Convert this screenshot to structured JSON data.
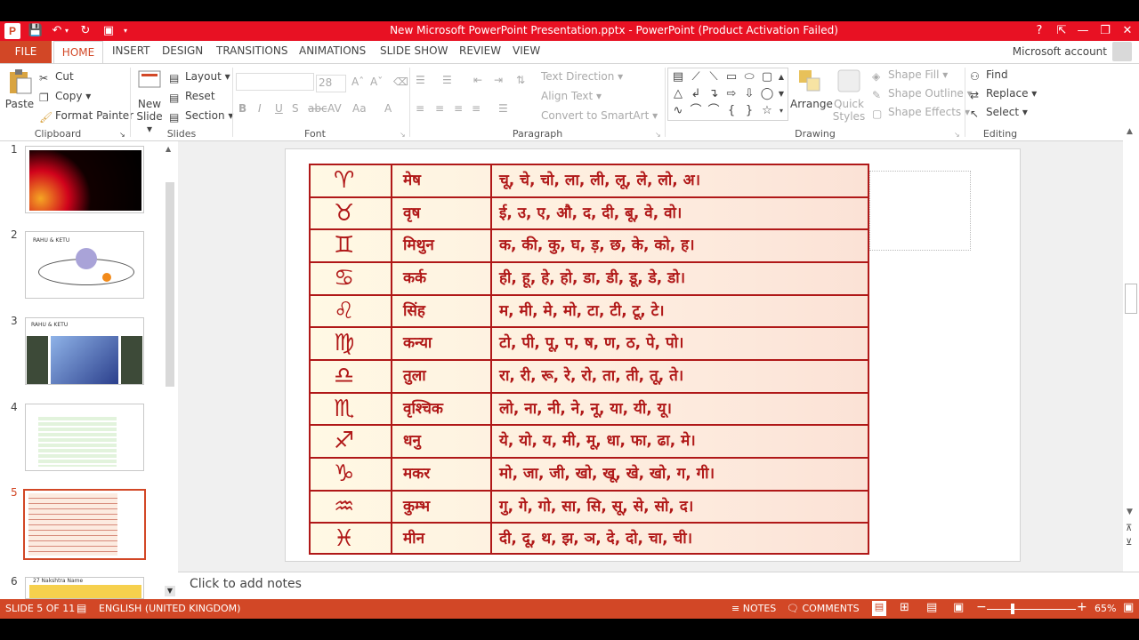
{
  "window": {
    "app_logo": "P",
    "title": "New Microsoft PowerPoint Presentation.pptx -  PowerPoint (Product Activation Failed)",
    "help": "?"
  },
  "tabs": {
    "file": "FILE",
    "items": [
      "HOME",
      "INSERT",
      "DESIGN",
      "TRANSITIONS",
      "ANIMATIONS",
      "SLIDE SHOW",
      "REVIEW",
      "VIEW"
    ],
    "account": "Microsoft account"
  },
  "ribbon": {
    "clipboard": {
      "paste": "Paste",
      "cut": "Cut",
      "copy": "Copy",
      "format_painter": "Format Painter",
      "label": "Clipboard"
    },
    "slides": {
      "new_slide": "New Slide",
      "layout": "Layout",
      "reset": "Reset",
      "section": "Section",
      "label": "Slides"
    },
    "font": {
      "size": "28",
      "label": "Font"
    },
    "paragraph": {
      "text_direction": "Text Direction",
      "align_text": "Align Text",
      "convert_smartart": "Convert to SmartArt",
      "label": "Paragraph"
    },
    "drawing": {
      "arrange": "Arrange",
      "quick_styles": "Quick Styles",
      "shape_fill": "Shape Fill",
      "shape_outline": "Shape Outline",
      "shape_effects": "Shape Effects",
      "label": "Drawing"
    },
    "editing": {
      "find": "Find",
      "replace": "Replace",
      "select": "Select",
      "label": "Editing"
    }
  },
  "thumbnails": [
    {
      "num": "1",
      "caption": ""
    },
    {
      "num": "2",
      "caption": "RAHU & KETU"
    },
    {
      "num": "3",
      "caption": "RAHU & KETU"
    },
    {
      "num": "4",
      "caption": ""
    },
    {
      "num": "5",
      "caption": ""
    },
    {
      "num": "6",
      "caption": "27 Nakshtra Name"
    }
  ],
  "slide": {
    "zodiac_table": [
      {
        "name": "मेष",
        "letters": "चू, चे, चो, ला, ली, लू, ले, लो, अ।"
      },
      {
        "name": "वृष",
        "letters": "ई, उ, ए, औ, द, दी, बू, वे, वो।"
      },
      {
        "name": "मिथुन",
        "letters": "क, की, कु, घ, ड़, छ, के, को, ह।"
      },
      {
        "name": "कर्क",
        "letters": "ही, हू, हे, हो, डा, डी, डू, डे, डो।"
      },
      {
        "name": "सिंह",
        "letters": "म, मी, मे, मो, टा, टी, टू, टे।"
      },
      {
        "name": "कन्या",
        "letters": "टो, पी, पू, प, ष, ण, ठ, पे, पो।"
      },
      {
        "name": "तुला",
        "letters": "रा, री, रू, रे, रो, ता, ती, तू, ते।"
      },
      {
        "name": "वृश्चिक",
        "letters": "लो, ना, नी, ने, नू, या, यी, यू।"
      },
      {
        "name": "धनु",
        "letters": "ये, यो, य, मी, मू, धा, फा, ढा, मे।"
      },
      {
        "name": "मकर",
        "letters": "मो, जा, जी, खो, खू, खे, खो, ग, गी।"
      },
      {
        "name": "कुम्भ",
        "letters": "गु, गे, गो, सा, सि, सू, से, सो, द।"
      },
      {
        "name": "मीन",
        "letters": "दी, दू, थ, झ, ञ, दे, दो, चा, ची।"
      }
    ]
  },
  "notes": {
    "placeholder": "Click to add notes"
  },
  "status": {
    "slide_info": "SLIDE 5 OF 11",
    "language": "ENGLISH (UNITED KINGDOM)",
    "notes": "NOTES",
    "comments": "COMMENTS",
    "zoom": "65%"
  },
  "colors": {
    "accent": "#d24726",
    "title_bar": "#e81123",
    "table_red": "#b01818"
  }
}
